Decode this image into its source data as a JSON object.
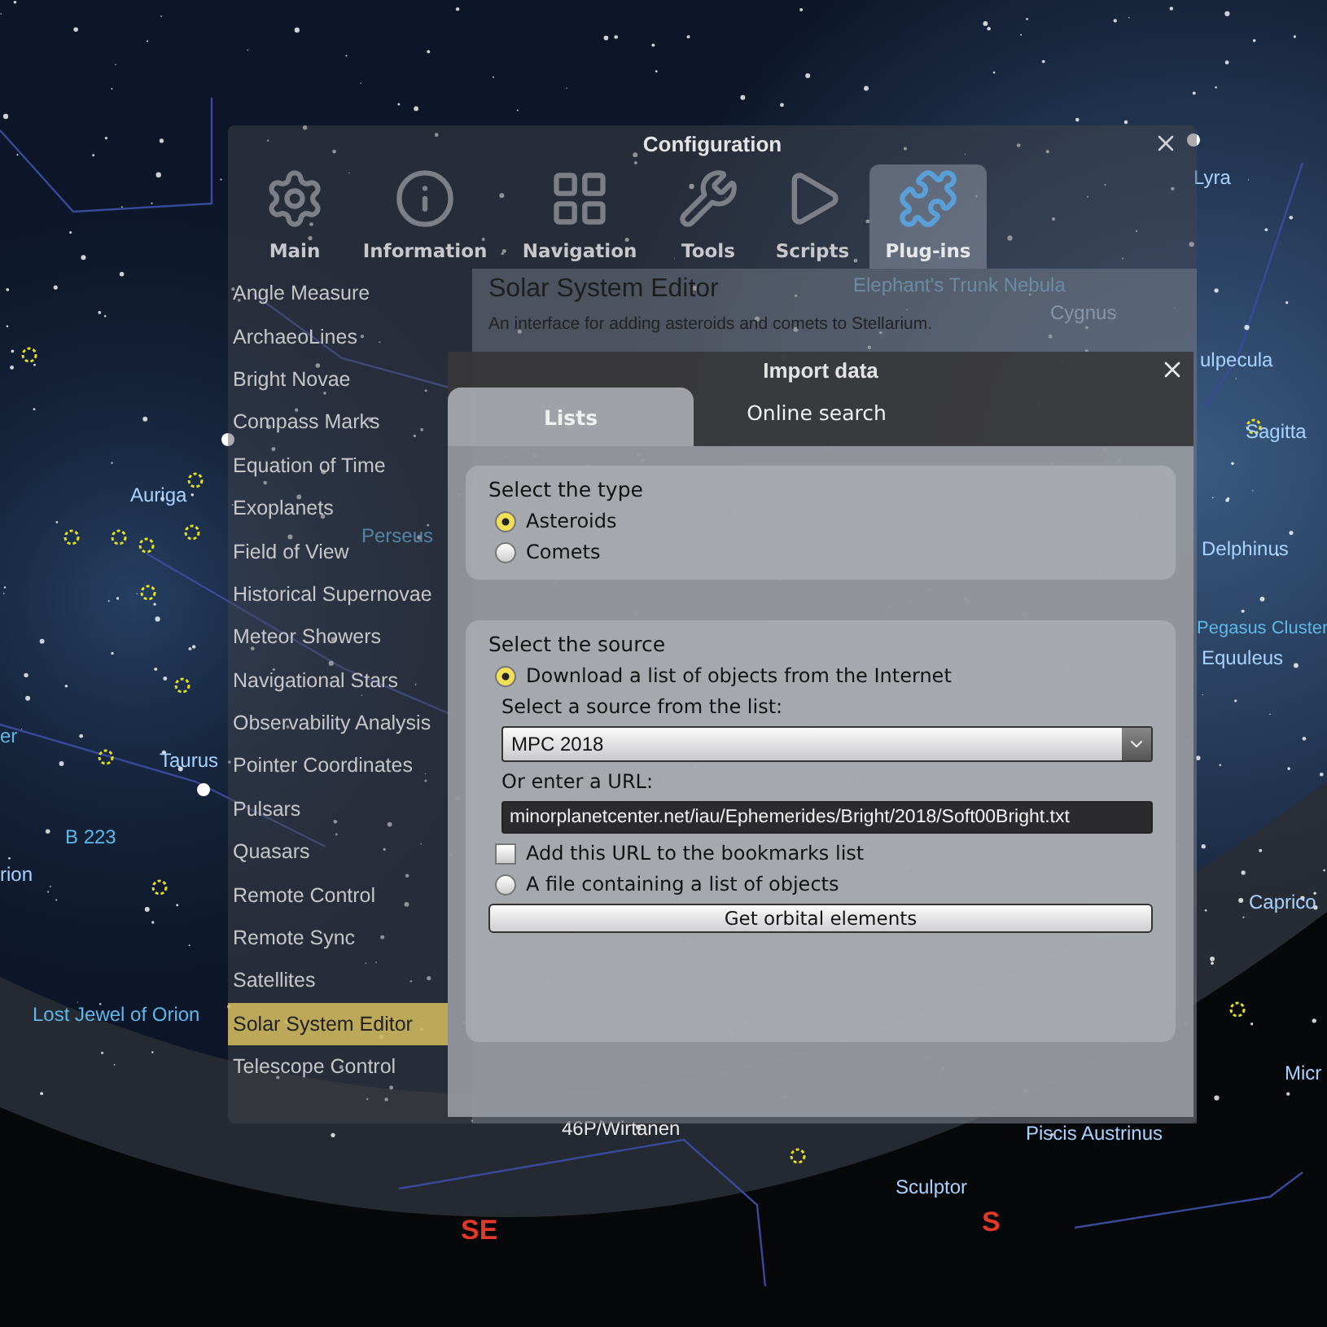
{
  "sky": {
    "labels": [
      {
        "text": "Lyra",
        "kind": "constellation"
      },
      {
        "text": "Elephant's Trunk Nebula",
        "kind": "object"
      },
      {
        "text": "Cygnus",
        "kind": "constellation"
      },
      {
        "text": "ulpecula",
        "kind": "constellation"
      },
      {
        "text": "Sagitta",
        "kind": "constellation"
      },
      {
        "text": "Delphinus",
        "kind": "constellation"
      },
      {
        "text": "Pegasus Cluster",
        "kind": "object"
      },
      {
        "text": "Equuleus",
        "kind": "constellation"
      },
      {
        "text": "Caprico",
        "kind": "constellation"
      },
      {
        "text": "Micr",
        "kind": "constellation"
      },
      {
        "text": "Piscis Austrinus",
        "kind": "constellation"
      },
      {
        "text": "Auriga",
        "kind": "constellation"
      },
      {
        "text": "Perseus",
        "kind": "object"
      },
      {
        "text": "er",
        "kind": "object"
      },
      {
        "text": "Taurus",
        "kind": "constellation"
      },
      {
        "text": "B 223",
        "kind": "object"
      },
      {
        "text": "rion",
        "kind": "constellation"
      },
      {
        "text": "Lost Jewel of Orion",
        "kind": "object"
      },
      {
        "text": "46P/Wirtanen",
        "kind": "comet"
      },
      {
        "text": "Sculptor",
        "kind": "constellation"
      },
      {
        "text": "SE",
        "kind": "cardinal"
      },
      {
        "text": "S",
        "kind": "cardinal"
      }
    ]
  },
  "configuration": {
    "title": "Configuration",
    "tabs": [
      {
        "label": "Main",
        "selected": false
      },
      {
        "label": "Information",
        "selected": false
      },
      {
        "label": "Navigation",
        "selected": false
      },
      {
        "label": "Tools",
        "selected": false
      },
      {
        "label": "Scripts",
        "selected": false
      },
      {
        "label": "Plug-ins",
        "selected": true
      }
    ],
    "plugins": [
      {
        "label": "Angle Measure",
        "selected": false
      },
      {
        "label": "ArchaeoLines",
        "selected": false
      },
      {
        "label": "Bright Novae",
        "selected": false
      },
      {
        "label": "Compass Marks",
        "selected": false
      },
      {
        "label": "Equation of Time",
        "selected": false
      },
      {
        "label": "Exoplanets",
        "selected": false
      },
      {
        "label": "Field of View",
        "selected": false
      },
      {
        "label": "Historical Supernovae",
        "selected": false
      },
      {
        "label": "Meteor Showers",
        "selected": false
      },
      {
        "label": "Navigational Stars",
        "selected": false
      },
      {
        "label": "Observability Analysis",
        "selected": false
      },
      {
        "label": "Pointer Coordinates",
        "selected": false
      },
      {
        "label": "Pulsars",
        "selected": false
      },
      {
        "label": "Quasars",
        "selected": false
      },
      {
        "label": "Remote Control",
        "selected": false
      },
      {
        "label": "Remote Sync",
        "selected": false
      },
      {
        "label": "Satellites",
        "selected": false
      },
      {
        "label": "Solar System Editor",
        "selected": true
      },
      {
        "label": "Telescope Control",
        "selected": false
      }
    ],
    "plugin_title": "Solar System Editor",
    "plugin_description": "An interface for adding asteroids and comets to Stellarium."
  },
  "import_dialog": {
    "title": "Import data",
    "tabs": [
      {
        "label": "Lists",
        "selected": true
      },
      {
        "label": "Online search",
        "selected": false
      }
    ],
    "type_group": {
      "title": "Select the type",
      "options": [
        {
          "label": "Asteroids",
          "selected": true
        },
        {
          "label": "Comets",
          "selected": false
        }
      ]
    },
    "source_group": {
      "title": "Select the source",
      "download_option": {
        "label": "Download a list of objects from the Internet",
        "selected": true
      },
      "source_label": "Select a source from the list:",
      "source_value": "MPC 2018",
      "url_label": "Or enter a URL:",
      "url_value": "minorplanetcenter.net/iau/Ephemerides/Bright/2018/Soft00Bright.txt",
      "bookmark": {
        "label": "Add this URL to the bookmarks list",
        "checked": false
      },
      "file_option": {
        "label": "A file containing a list of objects",
        "selected": false
      },
      "button": "Get orbital elements"
    }
  }
}
